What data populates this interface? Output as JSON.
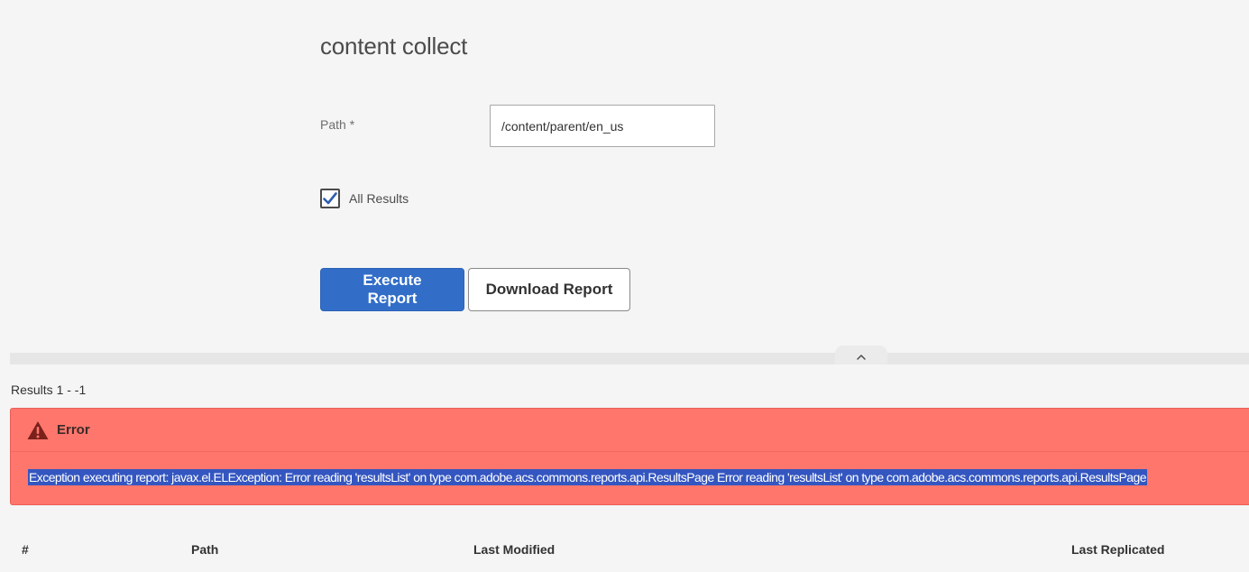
{
  "form": {
    "title": "content collect",
    "path_label": "Path *",
    "path_value": "/content/parent/en_us",
    "all_results_label": "All Results",
    "all_results_checked": true
  },
  "actions": {
    "execute_label": "Execute Report",
    "download_label": "Download Report"
  },
  "results": {
    "count_text": "Results 1 - -1",
    "error": {
      "title": "Error",
      "message": "Exception executing report: javax.el.ELException: Error reading 'resultsList' on type com.adobe.acs.commons.reports.api.ResultsPage Error reading 'resultsList' on type com.adobe.acs.commons.reports.api.ResultsPage"
    },
    "table": {
      "columns": [
        "#",
        "Path",
        "Last Modified",
        "Last Replicated"
      ]
    }
  },
  "icons": {
    "check": "checkmark-icon",
    "collapse": "chevron-up-icon",
    "alert": "alert-triangle-icon"
  },
  "colors": {
    "primary": "#326ec8",
    "error_bg": "#fe766c",
    "selection": "#3456c0"
  }
}
